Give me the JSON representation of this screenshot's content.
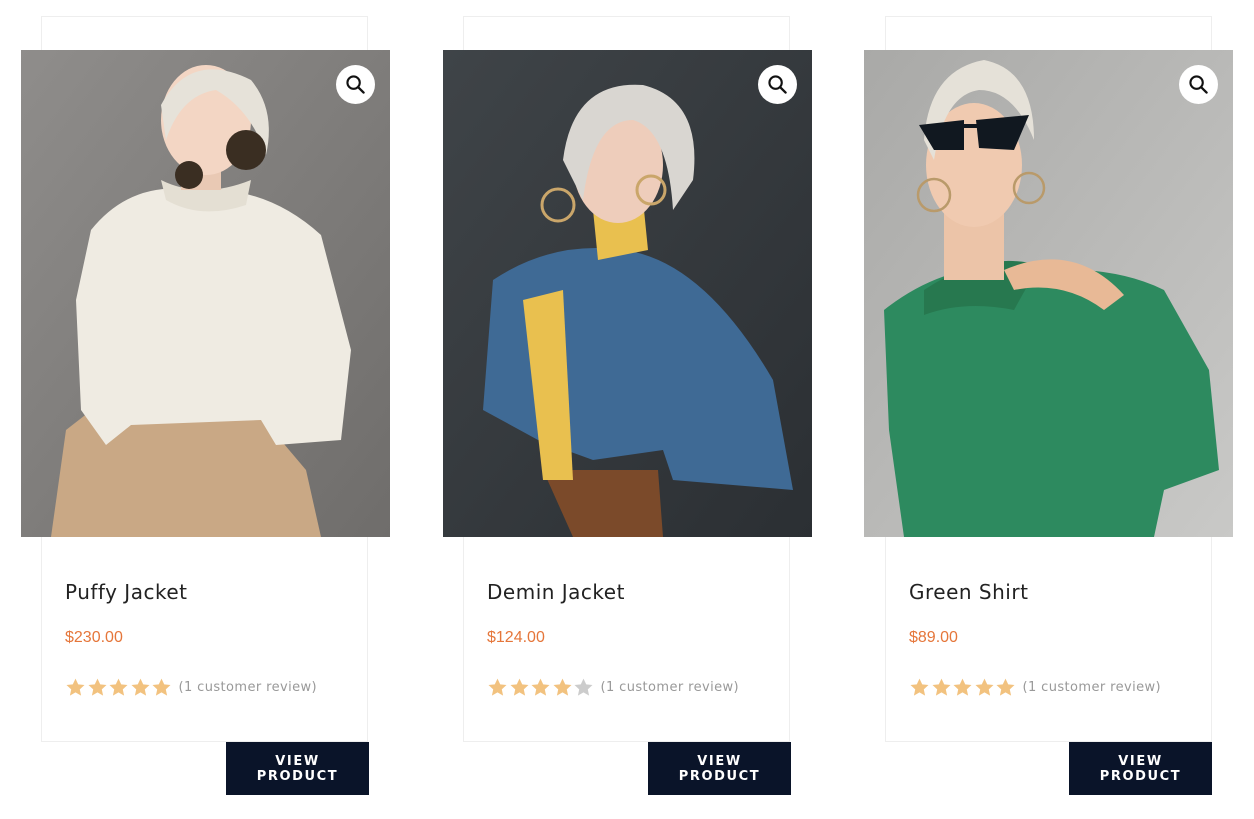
{
  "colors": {
    "price": "#e5763a",
    "star_filled": "#f2c27f",
    "star_empty": "#cccccc",
    "button_bg": "#0a1429",
    "button_text": "#ffffff"
  },
  "products": [
    {
      "image_alt": "Woman in white knit sweater and beige trousers",
      "title": "Puffy Jacket",
      "price": "$230.00",
      "rating": 5,
      "max_rating": 5,
      "review_text": "(1 customer review)",
      "button_label": "VIEW PRODUCT",
      "zoom_icon": "magnifier-icon"
    },
    {
      "image_alt": "Woman in denim jacket and yellow turtleneck",
      "title": "Demin Jacket",
      "price": "$124.00",
      "rating": 4,
      "max_rating": 5,
      "review_text": "(1 customer review)",
      "button_label": "VIEW PRODUCT",
      "zoom_icon": "magnifier-icon"
    },
    {
      "image_alt": "Woman in green off-shoulder shirt with sunglasses",
      "title": "Green Shirt",
      "price": "$89.00",
      "rating": 5,
      "max_rating": 5,
      "review_text": "(1 customer review)",
      "button_label": "VIEW PRODUCT",
      "zoom_icon": "magnifier-icon"
    }
  ]
}
